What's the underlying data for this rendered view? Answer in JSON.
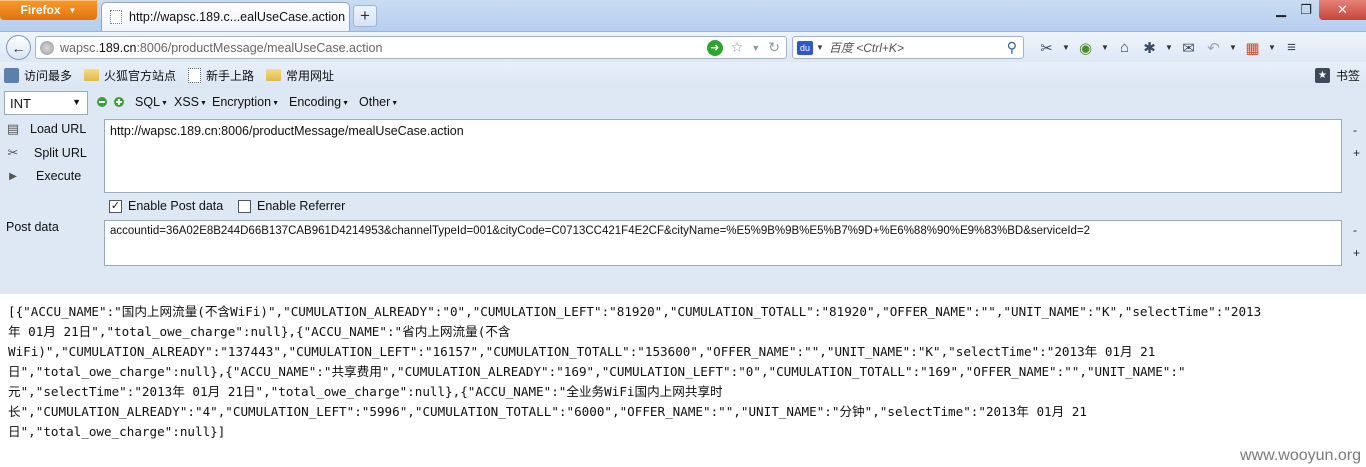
{
  "browser": {
    "app_button": "Firefox",
    "tab_title": "http://wapsc.189.c...ealUseCase.action",
    "new_tab": "+",
    "address_prefix": "wapsc.",
    "address_domain": "189.cn",
    "address_rest": ":8006/productMessage/mealUseCase.action",
    "search_placeholder": "百度 <Ctrl+K>",
    "icons": [
      "back-icon",
      "globe-icon",
      "go-icon",
      "star-icon",
      "dropdown-icon",
      "reload-icon",
      "search-icon",
      "tools-icon",
      "addon-icon",
      "home-icon",
      "bug-icon",
      "mail-icon",
      "undo-icon",
      "apps-icon",
      "menu-icon"
    ]
  },
  "bookmarks": {
    "items": [
      {
        "label": "访问最多",
        "icon": "gear-icon"
      },
      {
        "label": "火狐官方站点",
        "icon": "folder-icon"
      },
      {
        "label": "新手上路",
        "icon": "page-icon"
      },
      {
        "label": "常用网址",
        "icon": "folder-icon"
      }
    ],
    "right_label": "书签"
  },
  "hackbar": {
    "type_select": "INT",
    "menus": [
      "SQL",
      "XSS",
      "Encryption",
      "Encoding",
      "Other"
    ],
    "load_url": "Load URL",
    "split_url": "Split URL",
    "execute": "Execute",
    "url_value": "http://wapsc.189.cn:8006/productMessage/mealUseCase.action",
    "enable_post": "Enable Post data",
    "enable_post_checked": true,
    "enable_referrer": "Enable Referrer",
    "enable_referrer_checked": false,
    "post_label": "Post data",
    "post_value": "accountid=36A02E8B244D66B137CAB961D4214953&channelTypeId=001&cityCode=C0713CC421F4E2CF&cityName=%E5%9B%9B%E5%B7%9D+%E6%88%90%E9%83%BD&serviceId=2",
    "minus": "-",
    "plus": "+"
  },
  "response": {
    "lines": [
      "[{\"ACCU_NAME\":\"国内上网流量(不含WiFi)\",\"CUMULATION_ALREADY\":\"0\",\"CUMULATION_LEFT\":\"81920\",\"CUMULATION_TOTALL\":\"81920\",\"OFFER_NAME\":\"\",\"UNIT_NAME\":\"K\",\"selectTime\":\"2013",
      "年 01月 21日\",\"total_owe_charge\":null},{\"ACCU_NAME\":\"省内上网流量(不含",
      "WiFi)\",\"CUMULATION_ALREADY\":\"137443\",\"CUMULATION_LEFT\":\"16157\",\"CUMULATION_TOTALL\":\"153600\",\"OFFER_NAME\":\"\",\"UNIT_NAME\":\"K\",\"selectTime\":\"2013年 01月 21",
      "日\",\"total_owe_charge\":null},{\"ACCU_NAME\":\"共享费用\",\"CUMULATION_ALREADY\":\"169\",\"CUMULATION_LEFT\":\"0\",\"CUMULATION_TOTALL\":\"169\",\"OFFER_NAME\":\"\",\"UNIT_NAME\":\"",
      "元\",\"selectTime\":\"2013年 01月 21日\",\"total_owe_charge\":null},{\"ACCU_NAME\":\"全业务WiFi国内上网共享时",
      "长\",\"CUMULATION_ALREADY\":\"4\",\"CUMULATION_LEFT\":\"5996\",\"CUMULATION_TOTALL\":\"6000\",\"OFFER_NAME\":\"\",\"UNIT_NAME\":\"分钟\",\"selectTime\":\"2013年 01月 21",
      "日\",\"total_owe_charge\":null}]"
    ]
  },
  "watermark": "www.wooyun.org"
}
